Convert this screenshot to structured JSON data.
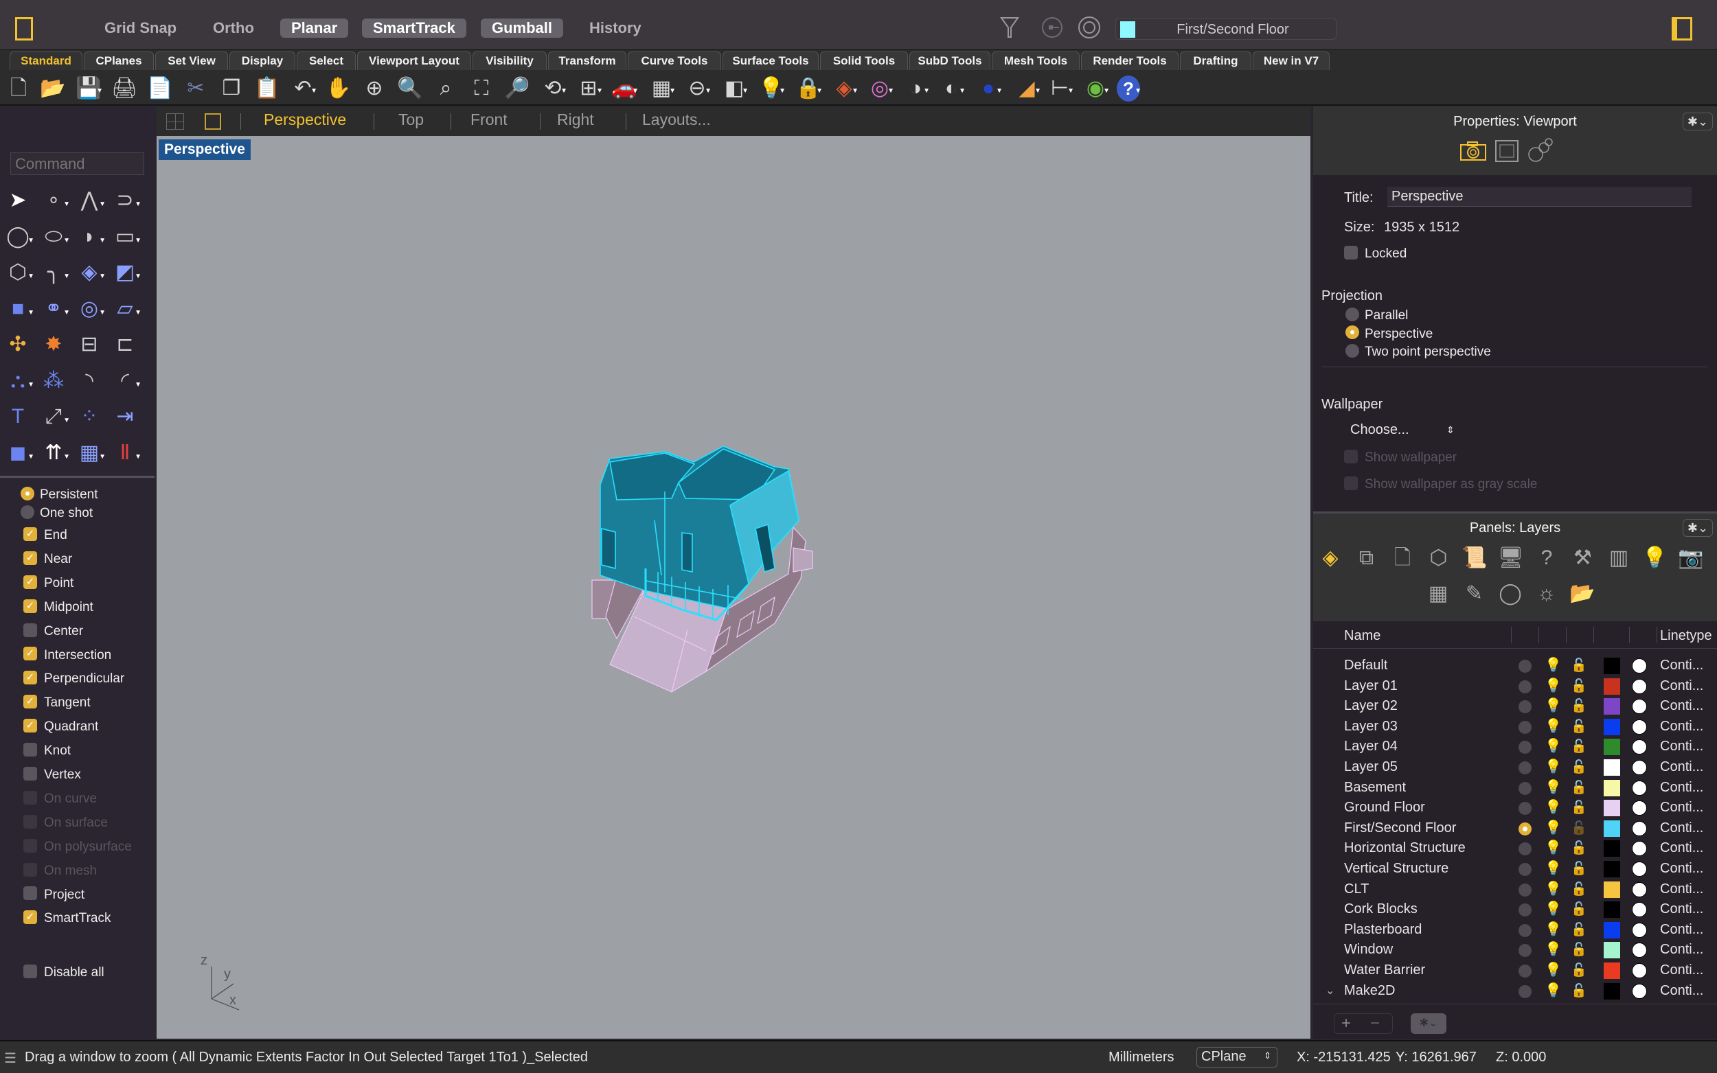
{
  "topbar": {
    "toggles": [
      {
        "label": "Grid Snap",
        "on": false
      },
      {
        "label": "Ortho",
        "on": false
      },
      {
        "label": "Planar",
        "on": true
      },
      {
        "label": "SmartTrack",
        "on": true
      },
      {
        "label": "Gumball",
        "on": true
      },
      {
        "label": "History",
        "on": false
      }
    ],
    "current_layer": "First/Second Floor",
    "current_layer_color": "#8ff8ff",
    "icons": [
      "filter-icon",
      "osnap-toggle-icon",
      "record-icon"
    ]
  },
  "ribbon_tabs": [
    "Standard",
    "CPlanes",
    "Set View",
    "Display",
    "Select",
    "Viewport Layout",
    "Visibility",
    "Transform",
    "Curve Tools",
    "Surface Tools",
    "Solid Tools",
    "SubD Tools",
    "Mesh Tools",
    "Render Tools",
    "Drafting",
    "New in V7"
  ],
  "ribbon_active": "Standard",
  "toolbar_icons": [
    {
      "name": "new-file-icon",
      "glyph": "🗋"
    },
    {
      "name": "open-folder-icon",
      "glyph": "📂"
    },
    {
      "name": "save-icon",
      "glyph": "💾"
    },
    {
      "name": "print-icon",
      "glyph": "🖨"
    },
    {
      "name": "import-icon",
      "glyph": "📄"
    },
    {
      "name": "cut-icon",
      "glyph": "✂"
    },
    {
      "name": "copy-icon",
      "glyph": "❐"
    },
    {
      "name": "paste-icon",
      "glyph": "📋"
    },
    {
      "name": "undo-icon",
      "glyph": "↶"
    },
    {
      "name": "pan-hand-icon",
      "glyph": "✋"
    },
    {
      "name": "rotate-view-icon",
      "glyph": "⊕"
    },
    {
      "name": "zoom-icon",
      "glyph": "🔍"
    },
    {
      "name": "zoom-window-icon",
      "glyph": "⌕"
    },
    {
      "name": "zoom-extents-icon",
      "glyph": "⛶"
    },
    {
      "name": "zoom-selected-icon",
      "glyph": "🔎"
    },
    {
      "name": "undo-view-icon",
      "glyph": "⟲"
    },
    {
      "name": "four-viewports-icon",
      "glyph": "⊞"
    },
    {
      "name": "car-icon",
      "glyph": "🚗"
    },
    {
      "name": "cplane-icon",
      "glyph": "▦"
    },
    {
      "name": "osnap-icon",
      "glyph": "⊖"
    },
    {
      "name": "object-properties-icon",
      "glyph": "◧"
    },
    {
      "name": "light-bulb-icon",
      "glyph": "💡"
    },
    {
      "name": "lock-icon",
      "glyph": "🔒"
    },
    {
      "name": "layer-icon",
      "glyph": "◈"
    },
    {
      "name": "color-wheel-icon",
      "glyph": "◎"
    },
    {
      "name": "shaded-sphere-icon",
      "glyph": "◑"
    },
    {
      "name": "rendered-sphere-icon",
      "glyph": "◐"
    },
    {
      "name": "render-ball-icon",
      "glyph": "●"
    },
    {
      "name": "spotlight-icon",
      "glyph": "◢"
    },
    {
      "name": "dimension-icon",
      "glyph": "⊢"
    },
    {
      "name": "grasshopper-icon",
      "glyph": "◉"
    },
    {
      "name": "help-icon",
      "glyph": "?"
    }
  ],
  "viewport_tabs": {
    "items": [
      "Perspective",
      "Top",
      "Front",
      "Right",
      "Layouts..."
    ],
    "active": "Perspective"
  },
  "viewport": {
    "label": "Perspective",
    "axes": {
      "x": "x",
      "y": "y",
      "z": "z"
    }
  },
  "command": {
    "placeholder": "Command"
  },
  "left_tools": [
    "select-arrow-icon",
    "point-icon",
    "polyline-icon",
    "curve-icon",
    "circle-icon",
    "ellipse-icon",
    "arc-icon",
    "rectangle-icon",
    "polygon-icon",
    "fillet-curve-icon",
    "surface-from-points-icon",
    "extrude-surface-icon",
    "box-icon",
    "sphere-icon",
    "loft-icon",
    "network-surface-icon",
    "join-icon",
    "explode-icon",
    "trim-icon",
    "split-icon",
    "boolean-union-icon",
    "boolean-split-icon",
    "offset-curve-icon",
    "blend-curve-icon",
    "text-icon",
    "scale-icon",
    "array-icon",
    "orient-icon",
    "block-icon",
    "extrude-icon",
    "grid-array-icon",
    "section-icon"
  ],
  "osnap": {
    "mode": [
      {
        "label": "Persistent",
        "selected": true
      },
      {
        "label": "One shot",
        "selected": false
      }
    ],
    "items": [
      {
        "label": "End",
        "checked": true,
        "enabled": true
      },
      {
        "label": "Near",
        "checked": true,
        "enabled": true
      },
      {
        "label": "Point",
        "checked": true,
        "enabled": true
      },
      {
        "label": "Midpoint",
        "checked": true,
        "enabled": true
      },
      {
        "label": "Center",
        "checked": false,
        "enabled": true
      },
      {
        "label": "Intersection",
        "checked": true,
        "enabled": true
      },
      {
        "label": "Perpendicular",
        "checked": true,
        "enabled": true
      },
      {
        "label": "Tangent",
        "checked": true,
        "enabled": true
      },
      {
        "label": "Quadrant",
        "checked": true,
        "enabled": true
      },
      {
        "label": "Knot",
        "checked": false,
        "enabled": true
      },
      {
        "label": "Vertex",
        "checked": false,
        "enabled": true
      },
      {
        "label": "On curve",
        "checked": false,
        "enabled": false
      },
      {
        "label": "On surface",
        "checked": false,
        "enabled": false
      },
      {
        "label": "On polysurface",
        "checked": false,
        "enabled": false
      },
      {
        "label": "On mesh",
        "checked": false,
        "enabled": false
      },
      {
        "label": "Project",
        "checked": false,
        "enabled": true
      },
      {
        "label": "SmartTrack",
        "checked": true,
        "enabled": true
      }
    ],
    "disable_all": {
      "label": "Disable all",
      "checked": false
    }
  },
  "properties": {
    "title": "Properties: Viewport",
    "title_label": "Title:",
    "title_value": "Perspective",
    "size_label": "Size:",
    "size_value": "1935 x 1512",
    "locked_label": "Locked",
    "locked": false,
    "projection_label": "Projection",
    "projection_options": [
      {
        "label": "Parallel",
        "selected": false
      },
      {
        "label": "Perspective",
        "selected": true
      },
      {
        "label": "Two point perspective",
        "selected": false
      }
    ],
    "wallpaper_label": "Wallpaper",
    "wallpaper_choose": "Choose...",
    "show_wallpaper": "Show wallpaper",
    "show_wallpaper_gray": "Show wallpaper as gray scale"
  },
  "layers": {
    "title": "Panels: Layers",
    "col_name": "Name",
    "col_linetype": "Linetype",
    "rows": [
      {
        "name": "Default",
        "current": false,
        "on": true,
        "locked": false,
        "color": "#000000",
        "linetype": "Conti..."
      },
      {
        "name": "Layer 01",
        "current": false,
        "on": true,
        "locked": false,
        "color": "#c8321e",
        "linetype": "Conti..."
      },
      {
        "name": "Layer 02",
        "current": false,
        "on": true,
        "locked": false,
        "color": "#7d45c8",
        "linetype": "Conti..."
      },
      {
        "name": "Layer 03",
        "current": false,
        "on": true,
        "locked": false,
        "color": "#0a3cf0",
        "linetype": "Conti..."
      },
      {
        "name": "Layer 04",
        "current": false,
        "on": true,
        "locked": false,
        "color": "#2e8a2a",
        "linetype": "Conti..."
      },
      {
        "name": "Layer 05",
        "current": false,
        "on": true,
        "locked": false,
        "color": "#ffffff",
        "linetype": "Conti..."
      },
      {
        "name": "Basement",
        "current": false,
        "on": false,
        "locked": false,
        "color": "#f7f7a8",
        "linetype": "Conti..."
      },
      {
        "name": "Ground Floor",
        "current": false,
        "on": true,
        "locked": false,
        "color": "#e8d0f2",
        "linetype": "Conti..."
      },
      {
        "name": "First/Second Floor",
        "current": true,
        "on": true,
        "locked": false,
        "color": "#4fd3f7",
        "linetype": "Conti..."
      },
      {
        "name": "Horizontal Structure",
        "current": false,
        "on": false,
        "locked": false,
        "color": "#000000",
        "linetype": "Conti..."
      },
      {
        "name": "Vertical Structure",
        "current": false,
        "on": false,
        "locked": false,
        "color": "#000000",
        "linetype": "Conti..."
      },
      {
        "name": "CLT",
        "current": false,
        "on": false,
        "locked": false,
        "color": "#f5c542",
        "linetype": "Conti..."
      },
      {
        "name": "Cork Blocks",
        "current": false,
        "on": false,
        "locked": false,
        "color": "#000000",
        "linetype": "Conti..."
      },
      {
        "name": "Plasterboard",
        "current": false,
        "on": false,
        "locked": false,
        "color": "#0a3cf0",
        "linetype": "Conti..."
      },
      {
        "name": "Window",
        "current": false,
        "on": false,
        "locked": false,
        "color": "#a4f4cf",
        "linetype": "Conti..."
      },
      {
        "name": "Water Barrier",
        "current": false,
        "on": false,
        "locked": false,
        "color": "#ea3b22",
        "linetype": "Conti..."
      },
      {
        "name": "Make2D",
        "current": false,
        "on": true,
        "locked": false,
        "color": "#000000",
        "linetype": "Conti...",
        "expandable": true
      }
    ],
    "panel_icons": [
      "layers-icon",
      "layer-states-icon",
      "document-icon",
      "object-icon",
      "notes-icon",
      "display-icon",
      "help-icon",
      "tools-icon",
      "layouts-icon",
      "lights-icon",
      "named-views-icon",
      "grid-icon",
      "materials-icon",
      "render-icon",
      "sun-icon",
      "files-icon"
    ]
  },
  "statusbar": {
    "message": "Drag a window to zoom ( All Dynamic Extents Factor In Out Selected Target 1To1 )_Selected",
    "units": "Millimeters",
    "cplane": "CPlane",
    "x": "X: -215131.425",
    "y": "Y: 16261.967",
    "z": "Z: 0.000"
  }
}
